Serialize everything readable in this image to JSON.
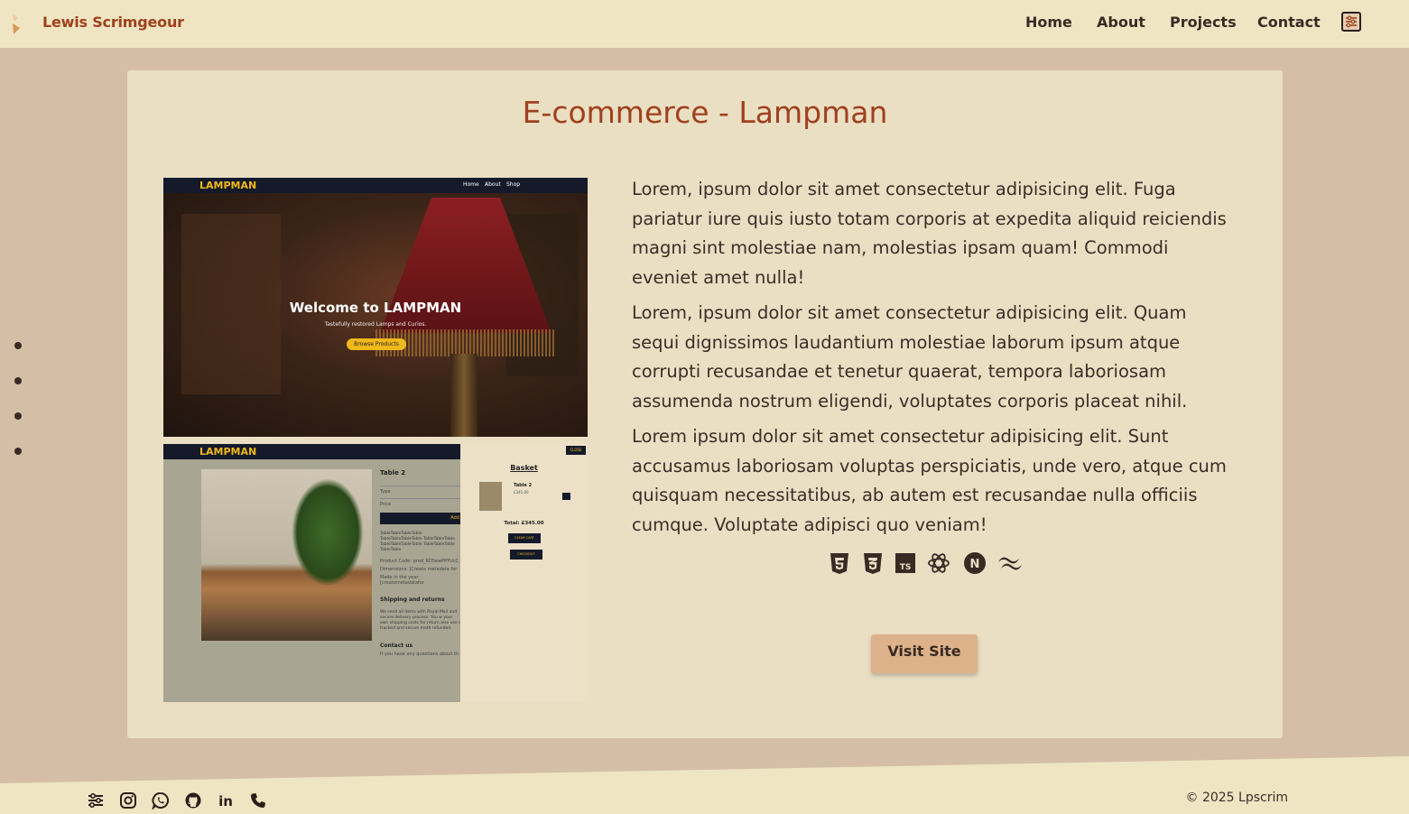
{
  "header": {
    "brand": "Lewis Scrimgeour",
    "nav": [
      {
        "label": "Home"
      },
      {
        "label": "About"
      },
      {
        "label": "Projects"
      },
      {
        "label": "Contact"
      }
    ],
    "settings_icon": "settings-icon"
  },
  "side_dots": [
    "dot-1",
    "dot-2",
    "dot-3",
    "dot-4"
  ],
  "project": {
    "title": "E-commerce - Lampman",
    "paragraphs": [
      "Lorem, ipsum dolor sit amet consectetur adipisicing elit. Fuga pariatur iure quis iusto totam corporis at expedita aliquid reiciendis magni sint molestiae nam, molestias ipsam quam! Commodi eveniet amet nulla!",
      "Lorem, ipsum dolor sit amet consectetur adipisicing elit. Quam sequi dignissimos laudantium molestiae laborum ipsum atque corrupti recusandae et tenetur quaerat, tempora laboriosam assumenda nostrum eligendi, voluptates corporis placeat nihil.",
      "Lorem ipsum dolor sit amet consectetur adipisicing elit. Sunt accusamus laboriosam voluptas perspiciatis, unde vero, atque cum quisquam necessitatibus, ab autem est recusandae nulla officiis cumque. Voluptate adipisci quo veniam!"
    ],
    "tech_icons": [
      "html5-icon",
      "css3-icon",
      "typescript-icon",
      "react-query-icon",
      "nextjs-icon",
      "tailwind-icon"
    ],
    "tech_ts_label": "TS",
    "tech_next_label": "N",
    "visit_label": "Visit Site",
    "screenshot_home": {
      "logo": "LAMPMAN",
      "nav": [
        "Home",
        "About",
        "Shop"
      ],
      "welcome": "Welcome to LAMPMAN",
      "subtitle": "Tastefully restored Lamps and Curios.",
      "button": "Browse Products"
    },
    "screenshot_product": {
      "logo": "LAMPMAN",
      "product_title": "Table 2",
      "type_label": "Type",
      "price_label": "Price",
      "add_label": "Add",
      "description": "TableTableTableTable TableTableTableTable TableTableTable TableTableTableTable TableTableTable TableTable",
      "product_code": "Product Code: prod_RD5ewPPYUcC",
      "dimensions": "Dimensions: [Create metadata for",
      "made_in": "Made in the year: [createmetadatafor",
      "shipping_heading": "Shipping and returns",
      "shipping_text": "We send all items with Royal Mail and secure delivery process. You w your own shipping costs for return also use a tracked and secure meth refunded.",
      "contact_heading": "Contact us",
      "contact_text": "If you have any questions about th",
      "basket_close": "CLOSE",
      "basket_title": "Basket",
      "basket_item": "Table 2",
      "basket_price": "£345.00",
      "basket_total": "Total: £345.00",
      "clear_cart": "CLEAR CART",
      "checkout": "CHECKOUT"
    }
  },
  "footer": {
    "icons": [
      "sliders-icon",
      "instagram-icon",
      "whatsapp-icon",
      "github-icon",
      "linkedin-icon",
      "phone-icon"
    ],
    "linkedin_label": "in",
    "copyright": "© 2025 Lpscrim"
  },
  "colors": {
    "accent": "#a0401c",
    "background": "#d4bfa6",
    "header": "#efe5c2",
    "card": "#eadfc3",
    "button": "#ddb28a"
  }
}
